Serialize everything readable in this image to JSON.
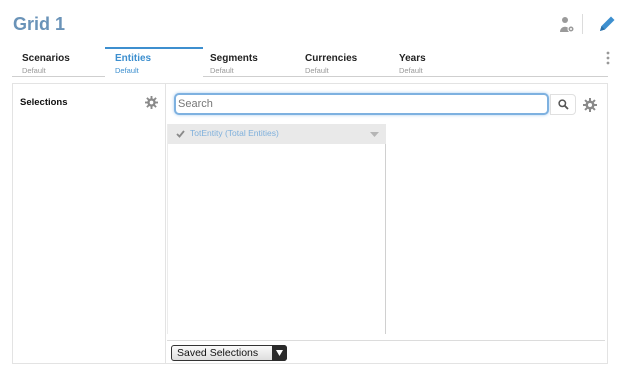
{
  "header": {
    "title": "Grid 1"
  },
  "tabs": [
    {
      "label": "Scenarios",
      "sub": "Default",
      "active": false
    },
    {
      "label": "Entities",
      "sub": "Default",
      "active": true
    },
    {
      "label": "Segments",
      "sub": "Default",
      "active": false
    },
    {
      "label": "Currencies",
      "sub": "Default",
      "active": false
    },
    {
      "label": "Years",
      "sub": "Default",
      "active": false
    }
  ],
  "selections": {
    "label": "Selections"
  },
  "search": {
    "placeholder": "Search",
    "value": ""
  },
  "tree": {
    "items": [
      {
        "label": "TotEntity (Total Entities)",
        "checked": true
      }
    ]
  },
  "saved_selections": {
    "label": "Saved Selections"
  },
  "colors": {
    "accent": "#3d8fcf",
    "title": "#6a93b8",
    "tree_text": "#7fb0dc"
  },
  "icons": {
    "user": "user-settings-icon",
    "edit": "pencil-icon",
    "more": "vertical-dots-icon",
    "gear": "gear-icon",
    "search": "magnifier-icon",
    "check": "checkmark-icon",
    "caret": "chevron-down-icon"
  }
}
